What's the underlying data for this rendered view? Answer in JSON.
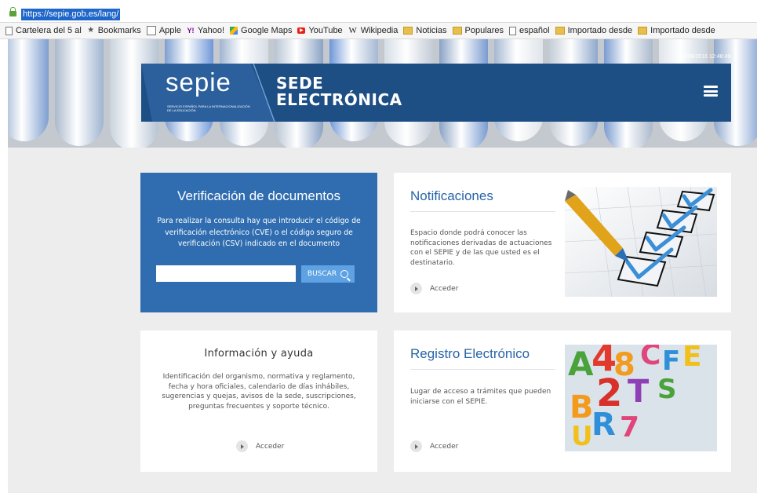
{
  "browser": {
    "url": "https://sepie.gob.es/lang/",
    "bookmarks": [
      {
        "label": "Cartelera del 5 al",
        "icon": "page-icon"
      },
      {
        "label": "Bookmarks",
        "icon": "star-icon"
      },
      {
        "label": "Apple",
        "icon": "apple-page-icon"
      },
      {
        "label": "Yahoo!",
        "icon": "yahoo-icon"
      },
      {
        "label": "Google Maps",
        "icon": "google-maps-icon"
      },
      {
        "label": "YouTube",
        "icon": "youtube-icon"
      },
      {
        "label": "Wikipedia",
        "icon": "wikipedia-icon"
      },
      {
        "label": "Noticias",
        "icon": "folder-icon"
      },
      {
        "label": "Populares",
        "icon": "folder-icon"
      },
      {
        "label": "español",
        "icon": "page-icon"
      },
      {
        "label": "Importado desde",
        "icon": "folder-icon"
      },
      {
        "label": "Importado desde",
        "icon": "folder-icon"
      }
    ]
  },
  "header": {
    "datetime": "14/06/2016 12:48:49",
    "logo_text": "sepie",
    "logo_subtitle": "SERVICIO ESPAÑOL PARA LA INTERNACIONALIZACIÓN DE LA EDUCACIÓN",
    "title_line1": "SEDE",
    "title_line2": "ELECTRÓNICA",
    "menu_icon": "hamburger-menu-icon"
  },
  "verificacion": {
    "title": "Verificación de documentos",
    "description": "Para realizar la consulta hay que introducir el código de verificación electrónico (CVE) o el código seguro de verificación (CSV) indicado en el documento",
    "input_value": "",
    "button_label": "BUSCAR"
  },
  "notificaciones": {
    "title": "Notificaciones",
    "description": "Espacio donde podrá conocer las notificaciones derivadas de actuaciones con el SEPIE y de las que usted es el destinatario.",
    "link": "Acceder"
  },
  "informacion": {
    "title": "Información y ayuda",
    "description": "Identificación del organismo, normativa y reglamento, fecha y hora oficiales, calendario de días inhábiles, sugerencias y quejas, avisos de la sede, suscripciones, preguntas frecuentes y soporte técnico.",
    "link": "Acceder"
  },
  "registro": {
    "title": "Registro Electrónico",
    "description": "Lugar de acceso a trámites que pueden iniciarse con el SEPIE.",
    "link": "Acceder"
  },
  "colors": {
    "banner": "#1d4e84",
    "verificacion_bg": "#2f6db0",
    "title_blue": "#2764a8",
    "buscar_button": "#5ea2e3"
  }
}
